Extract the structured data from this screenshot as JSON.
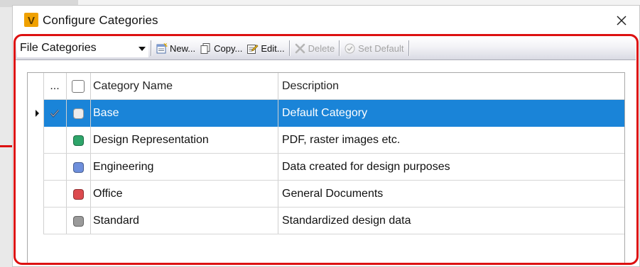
{
  "dialog": {
    "title": "Configure Categories",
    "app_logo_letter": "V"
  },
  "toolbar": {
    "category_type": "File Categories",
    "buttons": {
      "new": "New...",
      "copy": "Copy...",
      "edit": "Edit...",
      "delete": "Delete",
      "set_default": "Set Default"
    }
  },
  "grid": {
    "columns": {
      "default": "...",
      "name": "Category Name",
      "description": "Description"
    },
    "rows": [
      {
        "name": "Base",
        "description": "Default Category",
        "color": "#ececec",
        "is_default": true,
        "selected": true
      },
      {
        "name": "Design Representation",
        "description": "PDF, raster images etc.",
        "color": "#2ea56a",
        "is_default": false,
        "selected": false
      },
      {
        "name": "Engineering",
        "description": "Data created for design purposes",
        "color": "#6e8fdc",
        "is_default": false,
        "selected": false
      },
      {
        "name": "Office",
        "description": "General Documents",
        "color": "#dc4a4e",
        "is_default": false,
        "selected": false
      },
      {
        "name": "Standard",
        "description": "Standardized design data",
        "color": "#9a9a9a",
        "is_default": false,
        "selected": false
      }
    ]
  },
  "colors": {
    "selection": "#1a84d8",
    "callout": "#dd1111",
    "logo": "#f0a100"
  }
}
